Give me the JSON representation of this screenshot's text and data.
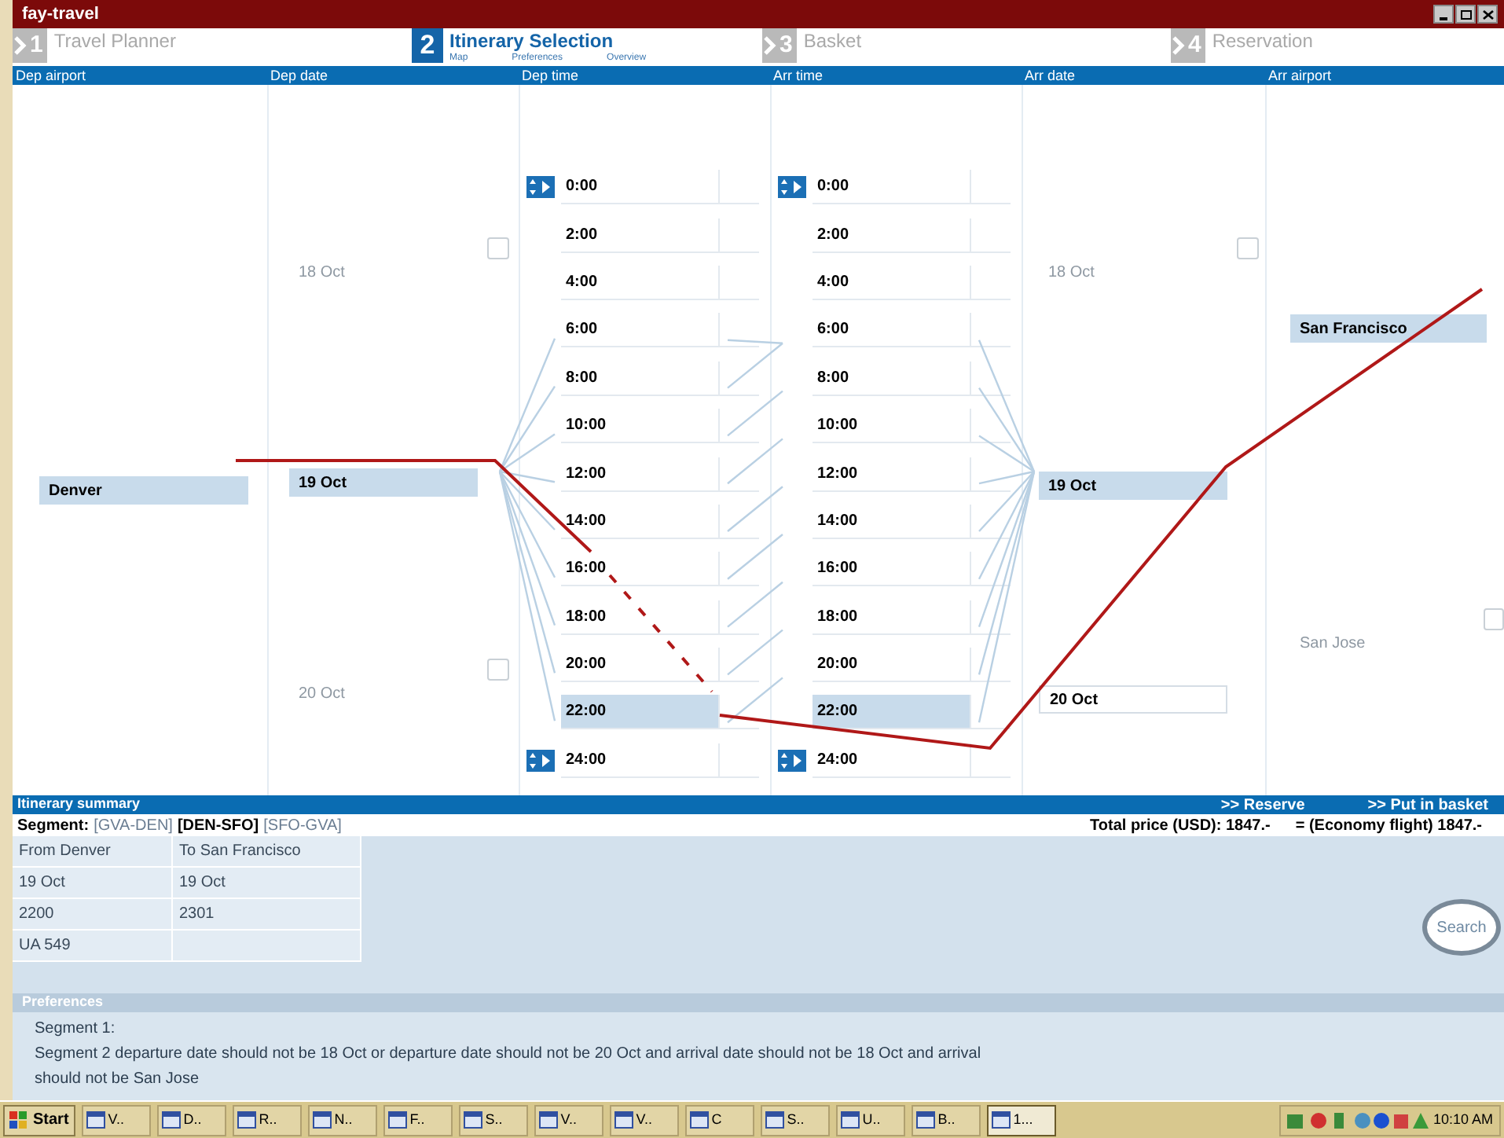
{
  "window": {
    "title": "fay-travel"
  },
  "steps": [
    {
      "number": "1",
      "label": "Travel Planner",
      "selected": false
    },
    {
      "number": "2",
      "label": "Itinerary Selection",
      "selected": true,
      "subitems": [
        "Map",
        "Preferences",
        "Overview"
      ]
    },
    {
      "number": "3",
      "label": "Basket",
      "selected": false
    },
    {
      "number": "4",
      "label": "Reservation",
      "selected": false
    }
  ],
  "columns": [
    "Dep airport",
    "Dep date",
    "Dep time",
    "Arr time",
    "Arr date",
    "Arr airport"
  ],
  "dep_airports": [
    {
      "label": "Denver",
      "selected": true
    }
  ],
  "dep_dates": [
    {
      "label": "18 Oct",
      "selected": false,
      "available": false,
      "checked": false
    },
    {
      "label": "19 Oct",
      "selected": true
    },
    {
      "label": "20 Oct",
      "selected": false,
      "available": false,
      "checked": false
    }
  ],
  "dep_times": [
    {
      "label": "0:00",
      "selected": false
    },
    {
      "label": "2:00",
      "selected": false
    },
    {
      "label": "4:00",
      "selected": false
    },
    {
      "label": "6:00",
      "selected": false
    },
    {
      "label": "8:00",
      "selected": false
    },
    {
      "label": "10:00",
      "selected": false
    },
    {
      "label": "12:00",
      "selected": false
    },
    {
      "label": "14:00",
      "selected": false
    },
    {
      "label": "16:00",
      "selected": false
    },
    {
      "label": "18:00",
      "selected": false
    },
    {
      "label": "20:00",
      "selected": false
    },
    {
      "label": "22:00",
      "selected": true
    },
    {
      "label": "24:00",
      "selected": false
    }
  ],
  "arr_times": [
    {
      "label": "0:00",
      "selected": false
    },
    {
      "label": "2:00",
      "selected": false
    },
    {
      "label": "4:00",
      "selected": false
    },
    {
      "label": "6:00",
      "selected": false
    },
    {
      "label": "8:00",
      "selected": false
    },
    {
      "label": "10:00",
      "selected": false
    },
    {
      "label": "12:00",
      "selected": false
    },
    {
      "label": "14:00",
      "selected": false
    },
    {
      "label": "16:00",
      "selected": false
    },
    {
      "label": "18:00",
      "selected": false
    },
    {
      "label": "20:00",
      "selected": false
    },
    {
      "label": "22:00",
      "selected": true
    },
    {
      "label": "24:00",
      "selected": false
    }
  ],
  "arr_dates": [
    {
      "label": "18 Oct",
      "selected": false,
      "available": false,
      "checked": false
    },
    {
      "label": "19 Oct",
      "selected": true
    },
    {
      "label": "20 Oct",
      "selected": false,
      "available": true
    }
  ],
  "arr_airports": [
    {
      "label": "San Francisco",
      "selected": true
    },
    {
      "label": "San Jose",
      "selected": false,
      "available": false,
      "checked": false
    }
  ],
  "summary": {
    "title": "Itinerary summary",
    "actions": [
      ">> Reserve",
      ">> Put in basket"
    ],
    "segment_label": "Segment:",
    "segments": [
      {
        "label": "[GVA-DEN]",
        "selected": false
      },
      {
        "label": "[DEN-SFO]",
        "selected": true
      },
      {
        "label": "[SFO-GVA]",
        "selected": false
      }
    ],
    "total_price": "Total price (USD): 1847.-",
    "fare": "=  (Economy flight) 1847.-",
    "rows": [
      [
        "From Denver",
        "To San Francisco"
      ],
      [
        "19 Oct",
        "19 Oct"
      ],
      [
        "2200",
        "2301"
      ],
      [
        "UA 549"
      ]
    ],
    "search_button": "Search"
  },
  "preferences": {
    "title": "Preferences",
    "lines": [
      "Segment 1:",
      "Segment 2 departure date should not be 18 Oct or departure date should not be 20 Oct and arrival date should not be 18 Oct and arrival",
      "should not be San Jose"
    ]
  },
  "taskbar": {
    "start": "Start",
    "items": [
      {
        "label": "V..",
        "selected": false
      },
      {
        "label": "D..",
        "selected": false
      },
      {
        "label": "R..",
        "selected": false
      },
      {
        "label": "N..",
        "selected": false
      },
      {
        "label": "F..",
        "selected": false
      },
      {
        "label": "S..",
        "selected": false
      },
      {
        "label": "V..",
        "selected": false
      },
      {
        "label": "V..",
        "selected": false
      },
      {
        "label": "C",
        "selected": false
      },
      {
        "label": "S..",
        "selected": false
      },
      {
        "label": "U..",
        "selected": false
      },
      {
        "label": "B..",
        "selected": false
      },
      {
        "label": "1...",
        "selected": true
      }
    ],
    "clock": "10:10 AM"
  }
}
